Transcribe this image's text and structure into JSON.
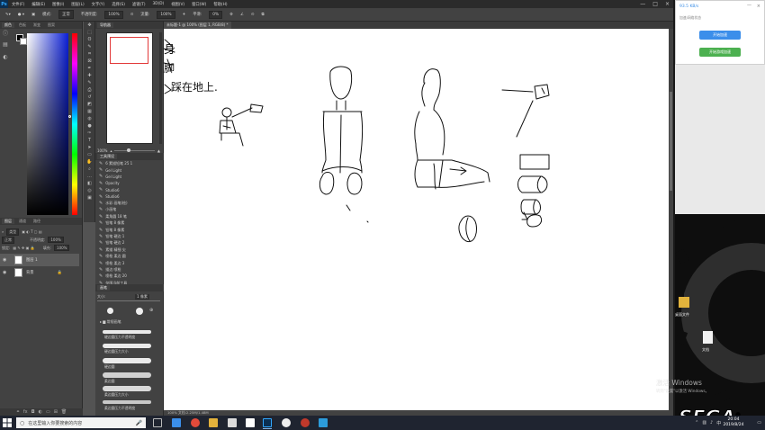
{
  "app": {
    "logo": "Ps",
    "menu": [
      "文件(F)",
      "编辑(E)",
      "图像(I)",
      "图层(L)",
      "文字(Y)",
      "选择(S)",
      "滤镜(T)",
      "3D(D)",
      "视图(V)",
      "窗口(W)",
      "帮助(H)"
    ],
    "window_controls": [
      "—",
      "□",
      "×"
    ]
  },
  "options_bar": {
    "mode_label": "模式:",
    "mode_value": "正常",
    "opacity_label": "不透明度:",
    "opacity_value": "100%",
    "flow_label": "流量:",
    "flow_value": "100%",
    "smooth_label": "平滑:",
    "smooth_value": "0%"
  },
  "color_panel": {
    "tabs": [
      "颜色",
      "色板",
      "渐变",
      "图案"
    ]
  },
  "layers_panel": {
    "tabs": [
      "图层",
      "通道",
      "路径"
    ],
    "kind_label": "类型",
    "blend_mode": "正常",
    "opacity_label": "不透明度:",
    "opacity_value": "100%",
    "lock_label": "锁定:",
    "fill_label": "填充:",
    "fill_value": "100%",
    "layers": [
      {
        "name": "图层 1"
      },
      {
        "name": "背景"
      }
    ]
  },
  "navigator": {
    "tab": "导航器",
    "zoom": "100%"
  },
  "history": {
    "tab": "工具预设",
    "items": [
      "6 素描铅笔 25 1",
      "Gel Light",
      "Gel Light",
      "Opacity",
      "Studio6",
      "Studio6",
      "水彩 画笔(绘)",
      "小画笔",
      "柔角圆 18 笔",
      "铅笔 8 像素",
      "铅笔 8 像素",
      "铅笔 硬边 1",
      "铅笔 硬边 2",
      "素描 精细 尖",
      "喷枪 柔边 圆",
      "喷枪 柔边 3",
      "描边 喷枪",
      "喷枪 柔边 20",
      "仅限当前工具"
    ]
  },
  "brushes": {
    "tab": "画笔",
    "size_label": "大小:",
    "size_value": "1 像素",
    "folder": "常规画笔",
    "items": [
      "硬边圆压力不透明度",
      "硬边圆压力大小",
      "硬边圆",
      "柔边圆",
      "柔边圆压力大小",
      "柔边圆压力不透明度"
    ]
  },
  "document": {
    "tab": "未标题-1 @ 100% (图层 1, RGB/8) *",
    "status": "100%  文档:2.25M/1.48M"
  },
  "sketch": {
    "text": [
      "身",
      "脚",
      "踩在地上."
    ]
  },
  "net_widget": {
    "title": "93.5 KB/s",
    "subtitle": "加速/网络状态",
    "button1": "开始加速",
    "button2": "开始游戏加速"
  },
  "video": {
    "logo": "SEGA",
    "registered": "®"
  },
  "desktop": {
    "icon1_label": "桌面文件",
    "icon2_label": "文档",
    "activate_watermark": "激活 Windows",
    "activate_sub": "转到\"设置\"以激活 Windows。"
  },
  "taskbar": {
    "search_placeholder": "在这里输入你要搜索的内容",
    "time": "20:04",
    "date": "2019/8/24"
  },
  "colors": {
    "accent_blue": "#3b8eea",
    "accent_green": "#4cb050",
    "ps_bg": "#535353"
  }
}
